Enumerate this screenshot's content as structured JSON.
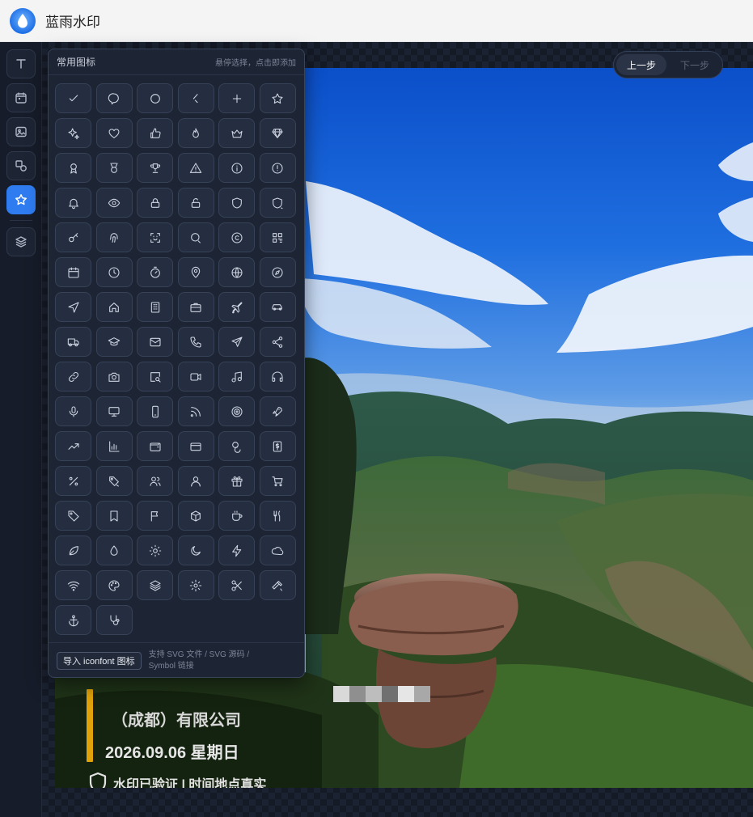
{
  "app": {
    "title": "蓝雨水印",
    "logo_icon": "water-drop-icon",
    "brand_color": "#2f7cf0"
  },
  "toolbar": {
    "tools": [
      {
        "name": "tool-text",
        "icon": "text-icon",
        "active": false
      },
      {
        "name": "tool-date",
        "icon": "calendar-icon",
        "active": false
      },
      {
        "name": "tool-image",
        "icon": "image-icon",
        "active": false
      },
      {
        "name": "tool-shape",
        "icon": "shapes-icon",
        "active": false
      },
      {
        "name": "tool-icon",
        "icon": "star-icon",
        "active": true
      },
      {
        "name": "tool-layers",
        "icon": "layers-icon",
        "active": false
      }
    ]
  },
  "history": {
    "undo_label": "上一步",
    "redo_label": "下一步"
  },
  "icon_panel": {
    "title": "常用图标",
    "hint": "悬停选择，点击即添加",
    "icons": [
      "check",
      "chat-bubble",
      "circle",
      "chevron-left",
      "plus",
      "star",
      "sparkles",
      "heart",
      "thumbs-up",
      "flame",
      "crown",
      "diamond",
      "ribbon",
      "medal",
      "trophy",
      "warning",
      "info",
      "alert",
      "bell",
      "eye",
      "lock",
      "unlock",
      "shield",
      "shield-check",
      "key",
      "fingerprint",
      "scan-face",
      "search",
      "copyright",
      "qr-code",
      "calendar",
      "clock",
      "timer",
      "map-pin",
      "globe",
      "compass",
      "navigation",
      "home",
      "building",
      "briefcase",
      "plane",
      "car",
      "truck",
      "graduation-cap",
      "mail",
      "phone",
      "send",
      "share",
      "link",
      "camera",
      "image-search",
      "video",
      "music",
      "headphones",
      "microphone",
      "monitor",
      "smartphone",
      "rss",
      "target",
      "rocket",
      "trending-up",
      "bar-chart",
      "wallet",
      "credit-card",
      "coins",
      "dollar",
      "percent",
      "tag-price",
      "users",
      "user",
      "gift",
      "cart",
      "tag",
      "bookmark",
      "flag",
      "box",
      "coffee",
      "utensils",
      "leaf",
      "droplet",
      "sun",
      "moon",
      "zap",
      "cloud",
      "wifi",
      "palette",
      "layers",
      "settings",
      "scissors",
      "hammer",
      "anchor",
      "stethoscope"
    ],
    "import_button": "导入 iconfont 图标",
    "footer_note": "支持 SVG 文件 / SVG 源码 / Symbol 链接"
  },
  "watermark": {
    "company": "（成都）有限公司",
    "date": "2026.09.06 星期日",
    "verified": "水印已验证 | 时间地点真实",
    "accent_color": "#e0a20a"
  }
}
